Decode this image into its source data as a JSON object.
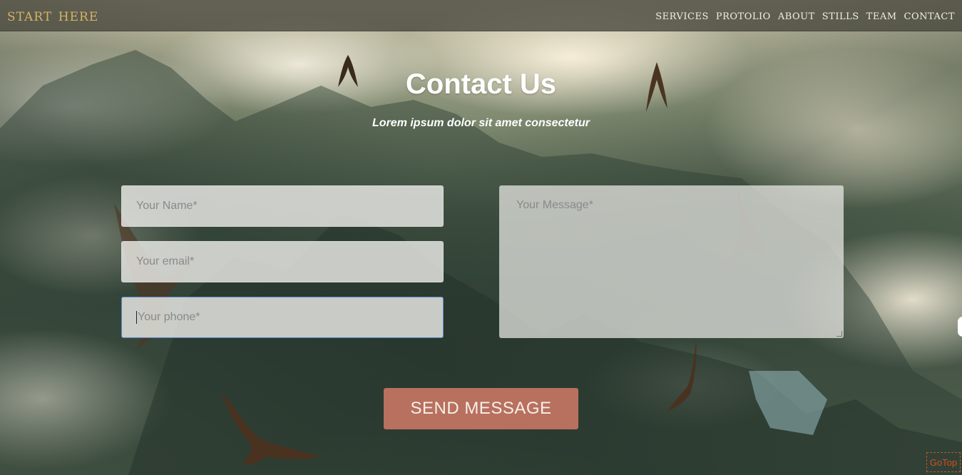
{
  "brand": "start here",
  "nav": [
    "services",
    "protolio",
    "about",
    "stills",
    "team",
    "contact"
  ],
  "heading": {
    "title": "Contact Us",
    "subtitle": "Lorem ipsum dolor sit amet consectetur"
  },
  "form": {
    "name_placeholder": "Your Name*",
    "email_placeholder": "Your email*",
    "phone_placeholder": "Your phone*",
    "message_placeholder": "Your Message*",
    "send_label": "SEND MESSAGE"
  },
  "gotop_label": "GoTop",
  "colors": {
    "brand": "#d6b363",
    "button": "#b8705f",
    "gotop": "#d24e1c"
  }
}
